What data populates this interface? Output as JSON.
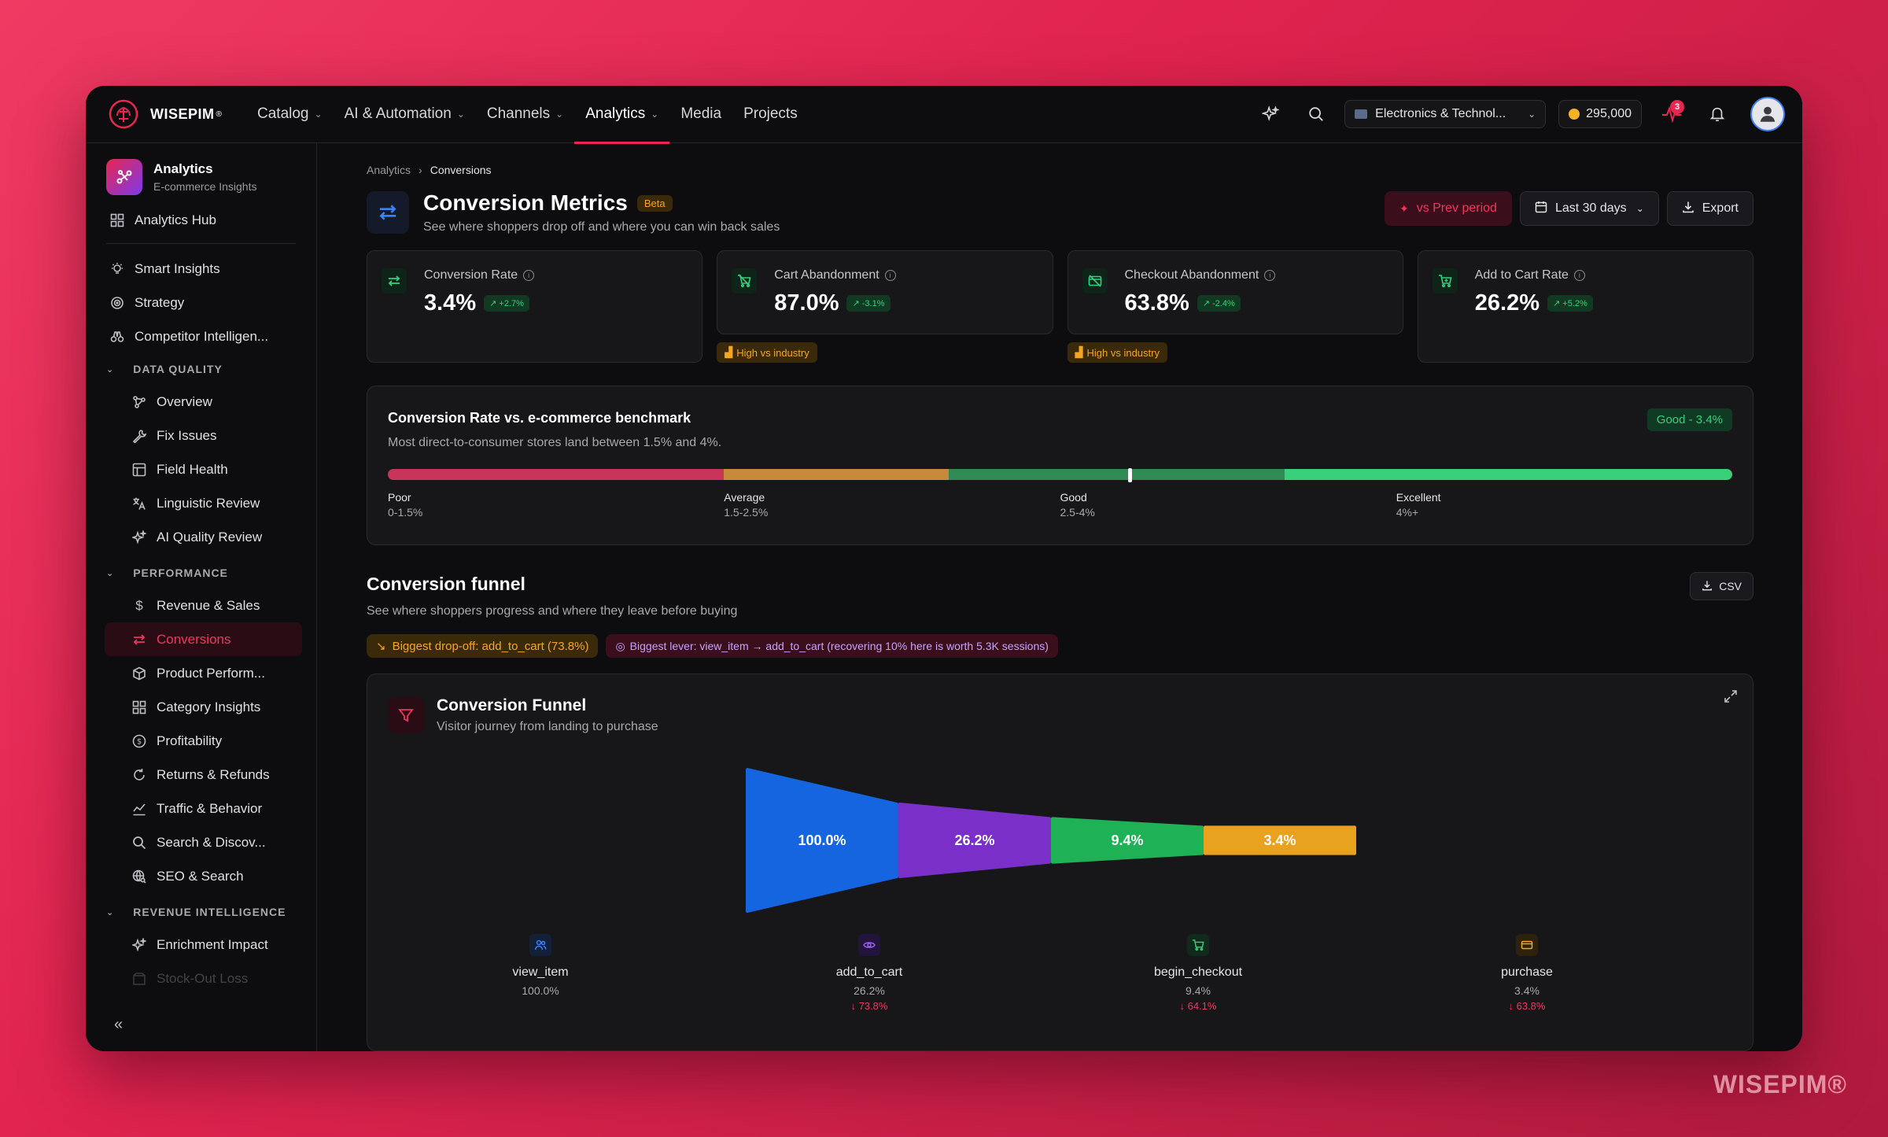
{
  "brand": {
    "name": "WISEPIM",
    "reg": "®",
    "watermark": "WISEPIM®"
  },
  "nav": [
    {
      "label": "Catalog",
      "dropdown": true
    },
    {
      "label": "AI & Automation",
      "dropdown": true
    },
    {
      "label": "Channels",
      "dropdown": true
    },
    {
      "label": "Analytics",
      "dropdown": true,
      "active": true
    },
    {
      "label": "Media",
      "dropdown": false
    },
    {
      "label": "Projects",
      "dropdown": false
    }
  ],
  "topbar": {
    "workspace": "Electronics & Technol...",
    "credits": "295,000",
    "activity_count": "3"
  },
  "sidebar": {
    "title": "Analytics",
    "subtitle": "E-commerce Insights",
    "hub": "Analytics Hub",
    "top_items": [
      "Smart Insights",
      "Strategy",
      "Competitor Intelligen..."
    ],
    "sections": {
      "data_quality": "DATA QUALITY",
      "performance": "PERFORMANCE",
      "revenue_intelligence": "REVENUE INTELLIGENCE"
    },
    "data_quality_items": [
      "Overview",
      "Fix Issues",
      "Field Health",
      "Linguistic Review",
      "AI Quality Review"
    ],
    "performance_items": [
      "Revenue & Sales",
      "Conversions",
      "Product Perform...",
      "Category Insights",
      "Profitability",
      "Returns & Refunds",
      "Traffic & Behavior",
      "Search & Discov...",
      "SEO & Search"
    ],
    "revenue_items": [
      "Enrichment Impact",
      "Stock-Out Loss"
    ],
    "active": "Conversions",
    "collapse": "«"
  },
  "breadcrumb": {
    "root": "Analytics",
    "current": "Conversions"
  },
  "page": {
    "title": "Conversion Metrics",
    "badge": "Beta",
    "subtitle": "See where shoppers drop off and where you can win back sales",
    "compare_btn": "vs Prev period",
    "range_btn": "Last 30 days",
    "export_btn": "Export"
  },
  "kpis": [
    {
      "label": "Conversion Rate",
      "value": "3.4%",
      "delta": "+2.7%",
      "tag": ""
    },
    {
      "label": "Cart Abandonment",
      "value": "87.0%",
      "delta": "-3.1%",
      "tag": "High vs industry"
    },
    {
      "label": "Checkout Abandonment",
      "value": "63.8%",
      "delta": "-2.4%",
      "tag": "High vs industry"
    },
    {
      "label": "Add to Cart Rate",
      "value": "26.2%",
      "delta": "+5.2%",
      "tag": ""
    }
  ],
  "benchmark": {
    "title": "Conversion Rate vs. e-commerce benchmark",
    "subtitle": "Most direct-to-consumer stores land between 1.5% and 4%.",
    "badge": "Good - 3.4%",
    "marker_fraction": 0.551,
    "segments": [
      {
        "name": "Poor",
        "range": "0-1.5%",
        "color": "#c8345a",
        "share": 0.25
      },
      {
        "name": "Average",
        "range": "1.5-2.5%",
        "color": "#c78a3a",
        "share": 0.167
      },
      {
        "name": "Good",
        "range": "2.5-4%",
        "color": "#2f8a53",
        "share": 0.25
      },
      {
        "name": "Excellent",
        "range": "4%+",
        "color": "#3ad07a",
        "share": 0.333
      }
    ]
  },
  "funnel_section": {
    "title": "Conversion funnel",
    "subtitle": "See where shoppers progress and where they leave before buying",
    "csv": "CSV",
    "chip_dropoff": "Biggest drop-off: add_to_cart (73.8%)",
    "chip_lever": "Biggest lever: view_item → add_to_cart (recovering 10% here is worth 5.3K sessions)"
  },
  "funnel": {
    "title": "Conversion Funnel",
    "subtitle": "Visitor journey from landing to purchase",
    "stages": [
      {
        "name": "view_item",
        "pct": "100.0%",
        "drop": "",
        "value": 100.0,
        "color": "#1565e0",
        "icon": "users-icon"
      },
      {
        "name": "add_to_cart",
        "pct": "26.2%",
        "drop": "↓ 73.8%",
        "value": 26.2,
        "color": "#7b2fc9",
        "icon": "eye-icon"
      },
      {
        "name": "begin_checkout",
        "pct": "9.4%",
        "drop": "↓ 64.1%",
        "value": 9.4,
        "color": "#1fb155",
        "icon": "cart-icon"
      },
      {
        "name": "purchase",
        "pct": "3.4%",
        "drop": "↓ 63.8%",
        "value": 3.4,
        "color": "#e8a21e",
        "icon": "card-icon"
      }
    ]
  }
}
